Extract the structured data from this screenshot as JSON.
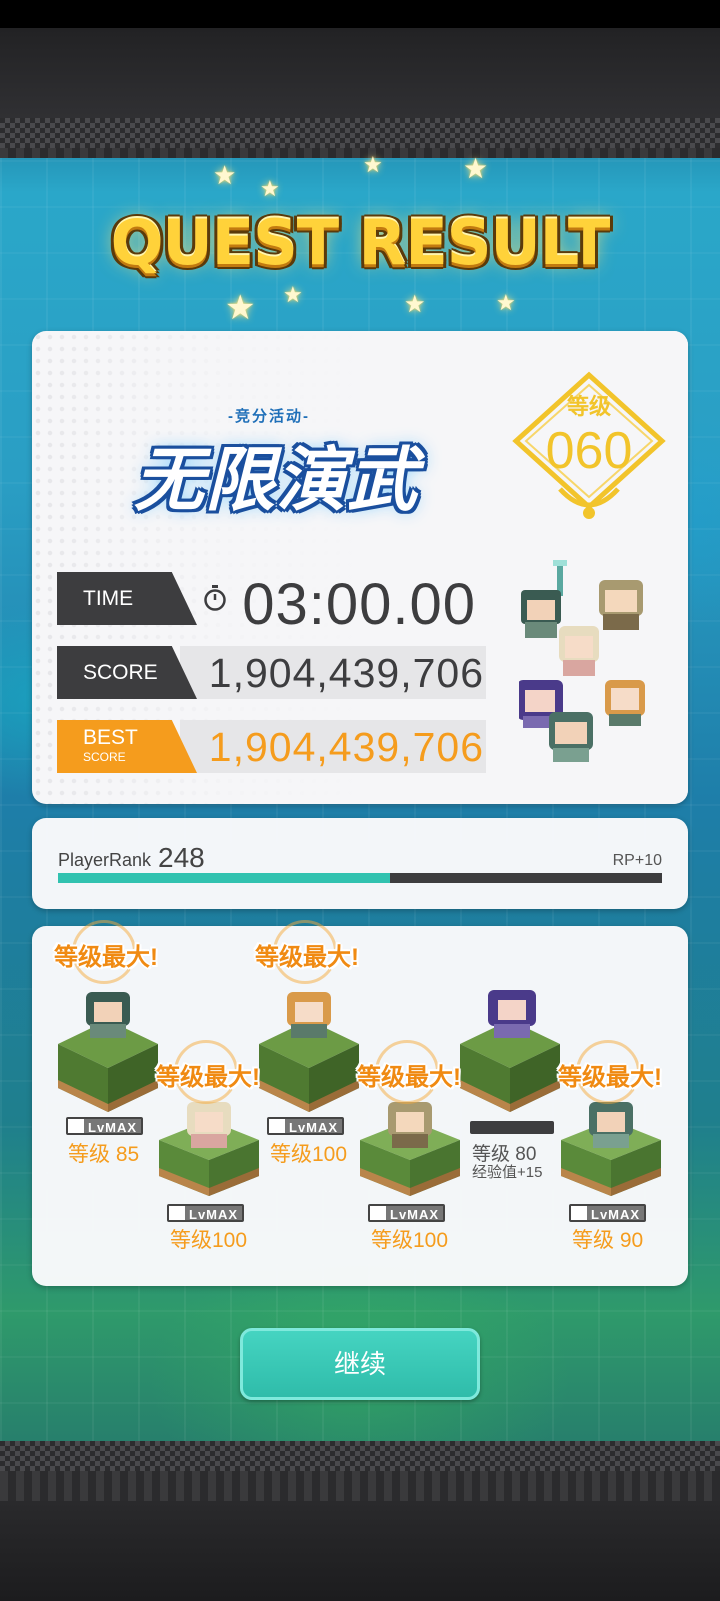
{
  "title": "QUEST RESULT",
  "event": {
    "subtitle": "-竞分活动-",
    "name": "无限演武"
  },
  "level_badge": {
    "label": "等级",
    "value": "060"
  },
  "stats": {
    "time_label": "TIME",
    "time_value": "03:00.00",
    "score_label": "SCORE",
    "score_value": "1,904,439,706",
    "best_label": "BEST",
    "best_sub": "SCORE",
    "best_value": "1,904,439,706"
  },
  "player_rank": {
    "label": "PlayerRank",
    "value": "248",
    "rp": "RP+10",
    "progress": 0.55
  },
  "units": [
    {
      "maxed": "等级最大!",
      "lvmax": "LvMAX",
      "level": "等级 85",
      "exp": ""
    },
    {
      "maxed": "等级最大!",
      "lvmax": "LvMAX",
      "level": "等级100",
      "exp": ""
    },
    {
      "maxed": "等级最大!",
      "lvmax": "LvMAX",
      "level": "等级100",
      "exp": ""
    },
    {
      "maxed": "等级最大!",
      "lvmax": "LvMAX",
      "level": "等级100",
      "exp": ""
    },
    {
      "maxed": "",
      "lvmax": "",
      "level": "等级 80",
      "exp": "经验值+15"
    },
    {
      "maxed": "等级最大!",
      "lvmax": "LvMAX",
      "level": "等级 90",
      "exp": ""
    }
  ],
  "continue_label": "继续",
  "colors": {
    "accent_orange": "#f59c1d",
    "accent_teal": "#31c2b0",
    "title_gold": "#ffd23a",
    "dark_tag": "#3d3d3f"
  }
}
